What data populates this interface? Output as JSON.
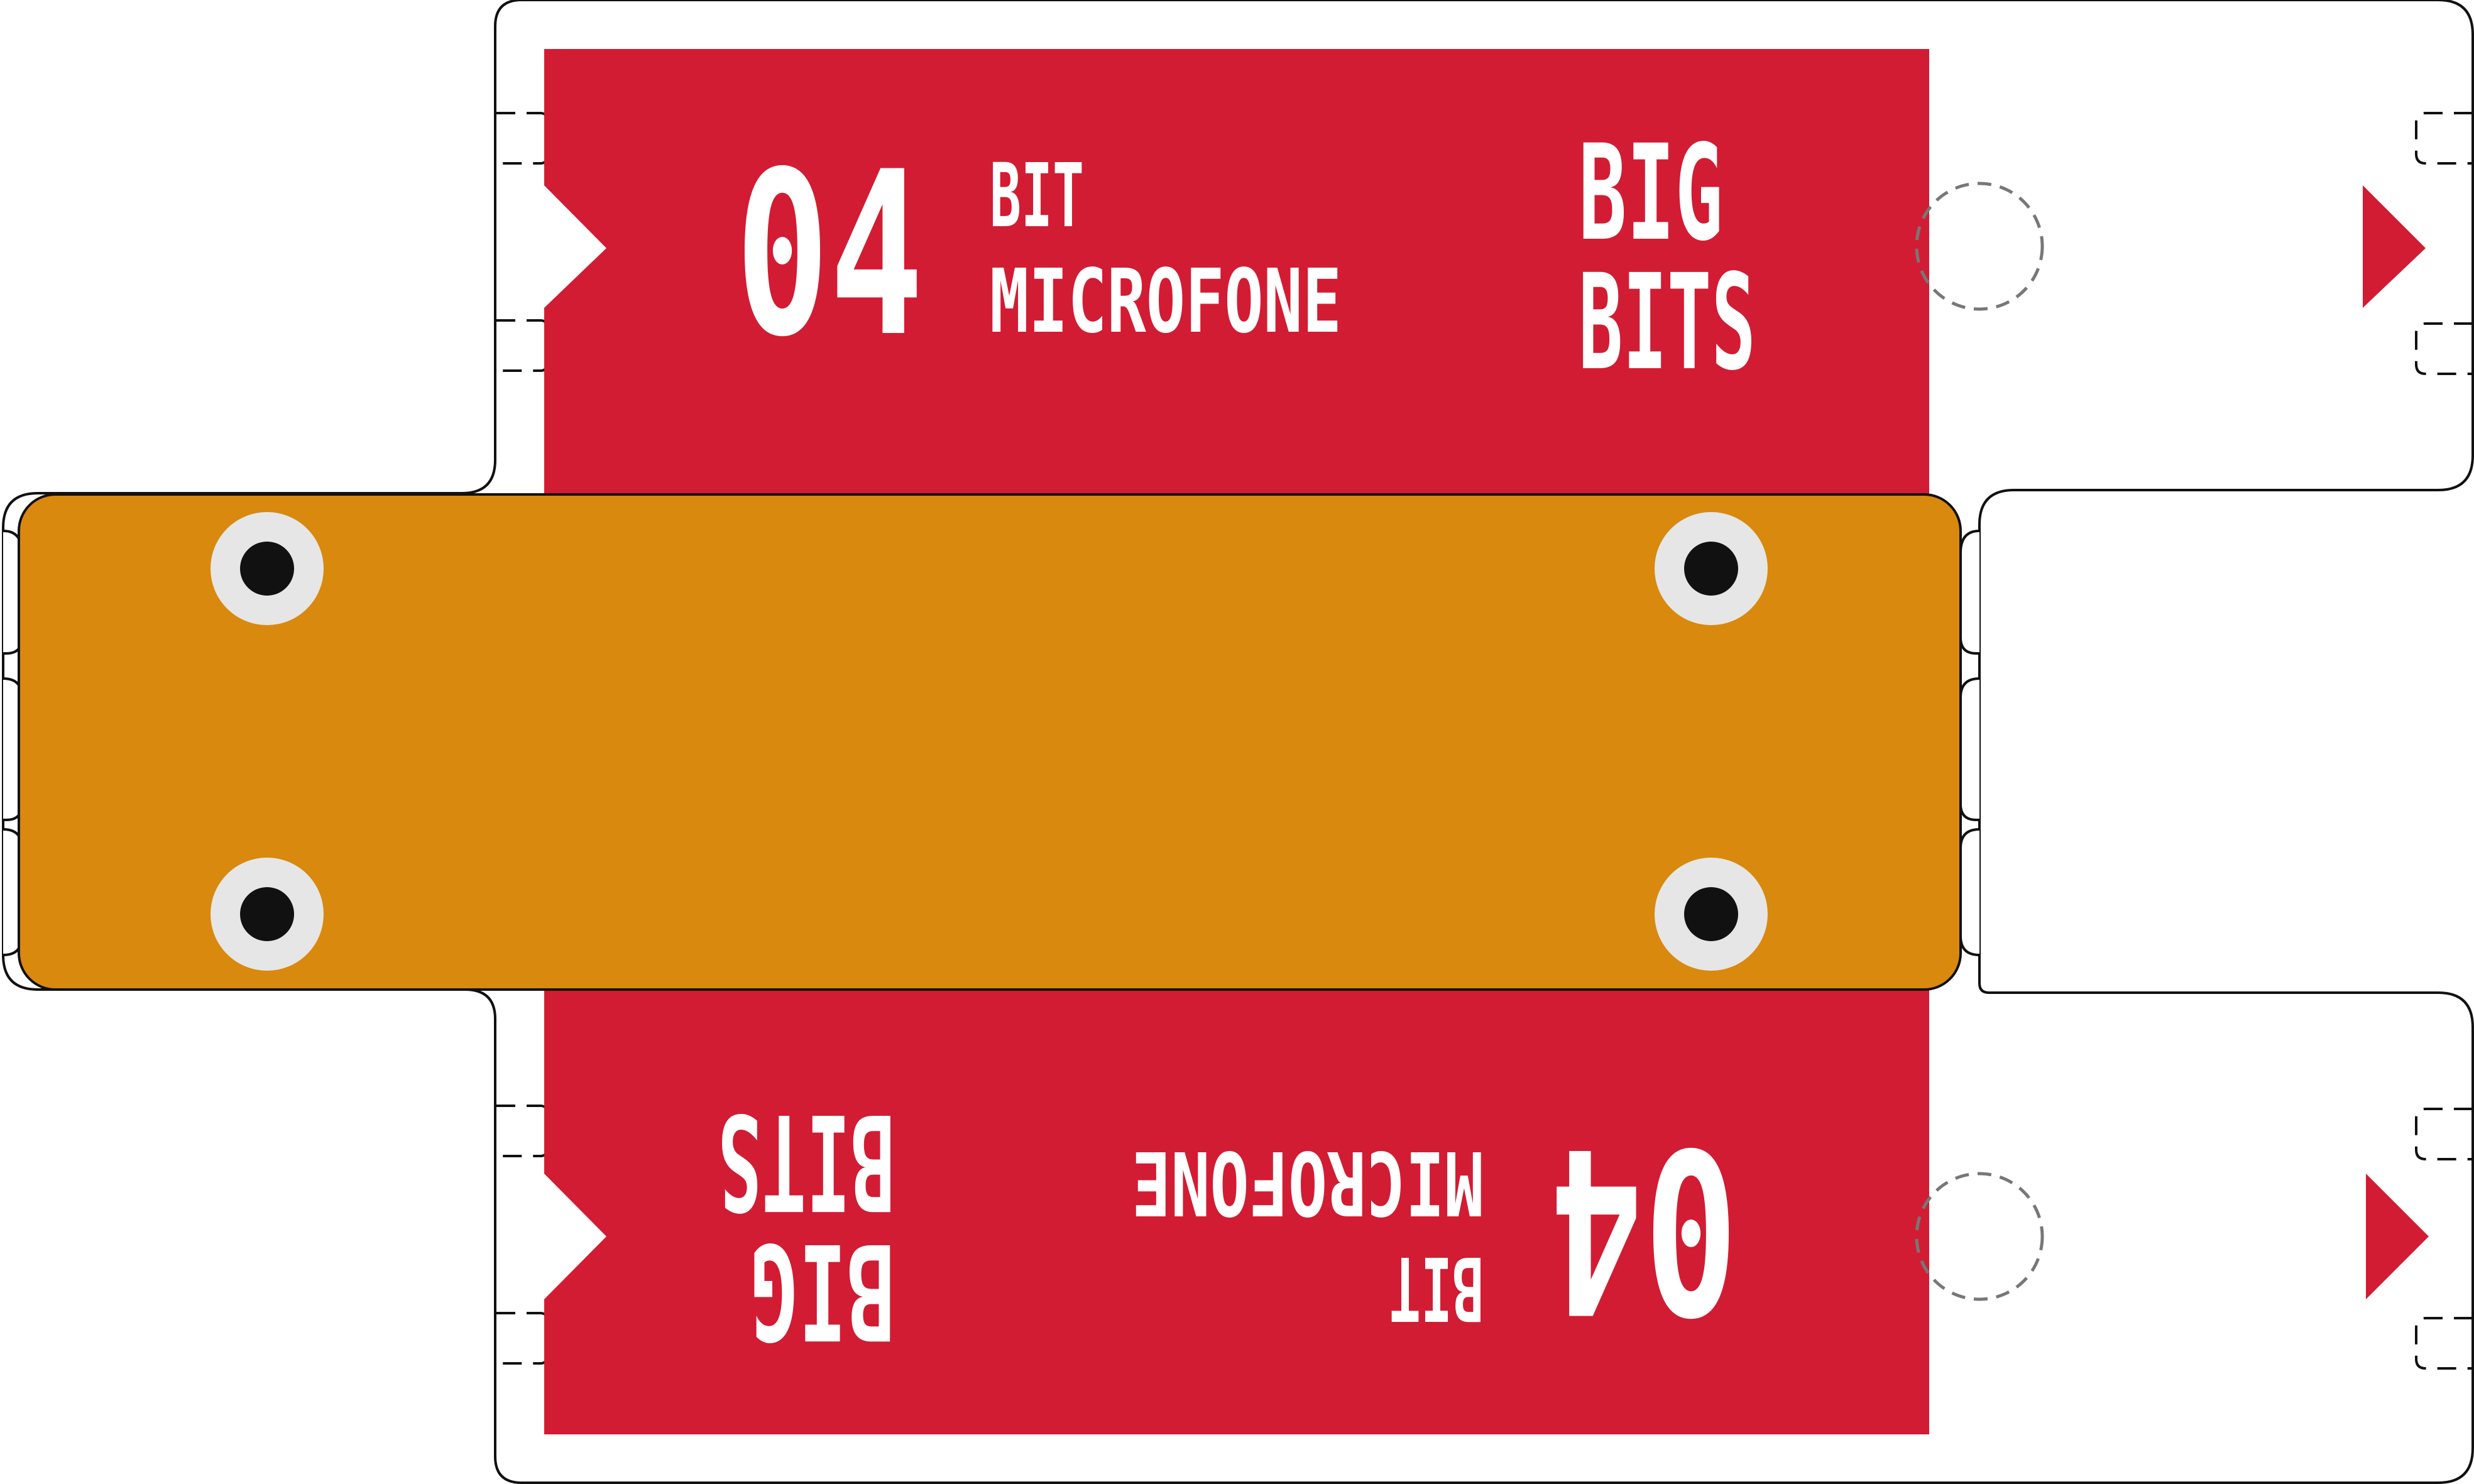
{
  "title": "",
  "colors": {
    "red_panel": "#D21C33",
    "orange_board": "#D8890E",
    "outline": "#111111",
    "pad_ring": "#E6E6E6",
    "pad_hole": "#111111",
    "white": "#FFFFFF",
    "dashed_circle": "#777777"
  },
  "top_panel": {
    "number": "04",
    "line1": "BIT",
    "line2": "MICROFONE",
    "logo_line1": "BIG",
    "logo_line2": "BITS"
  },
  "bottom_panel": {
    "number": "04",
    "line1": "BIT",
    "line2": "MICROFONE",
    "logo_line1": "BIG",
    "logo_line2": "BITS"
  },
  "icons": {
    "arrow_right": "triangle-right-icon",
    "arrow_left_notch": "notch-icon",
    "mount_hole": "mount-hole-icon"
  }
}
